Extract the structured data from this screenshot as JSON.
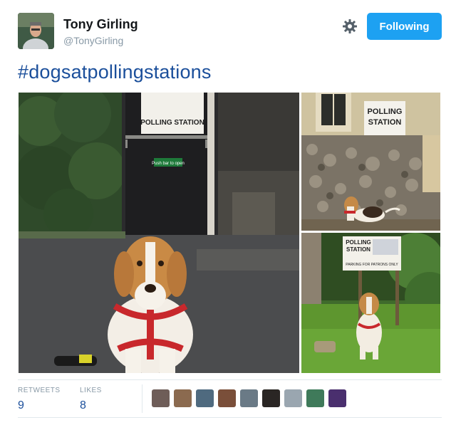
{
  "header": {
    "display_name": "Tony Girling",
    "handle": "@TonyGirling",
    "follow_label": "Following",
    "settings_icon": "gear-icon"
  },
  "tweet": {
    "text": "#dogsatpollingstations",
    "photos": [
      {
        "description": "beagle-harness-polling-door",
        "sign_text": "POLLING STATION",
        "door_sign_text": "Push bar to open"
      },
      {
        "description": "beagle-flint-wall",
        "sign_text": "POLLING\nSTATION"
      },
      {
        "description": "beagle-grass-sign",
        "sign_text": "POLLING STATION",
        "sub_text": "PARKING FOR PATRONS ONLY"
      }
    ]
  },
  "stats": {
    "retweets_label": "RETWEETS",
    "retweets_count": "9",
    "likes_label": "LIKES",
    "likes_count": "8",
    "likers_count": 9
  },
  "colors": {
    "accent": "#1da1f2",
    "link": "#1b4f9b",
    "muted": "#8899a6",
    "divider": "#e1e8ed"
  }
}
